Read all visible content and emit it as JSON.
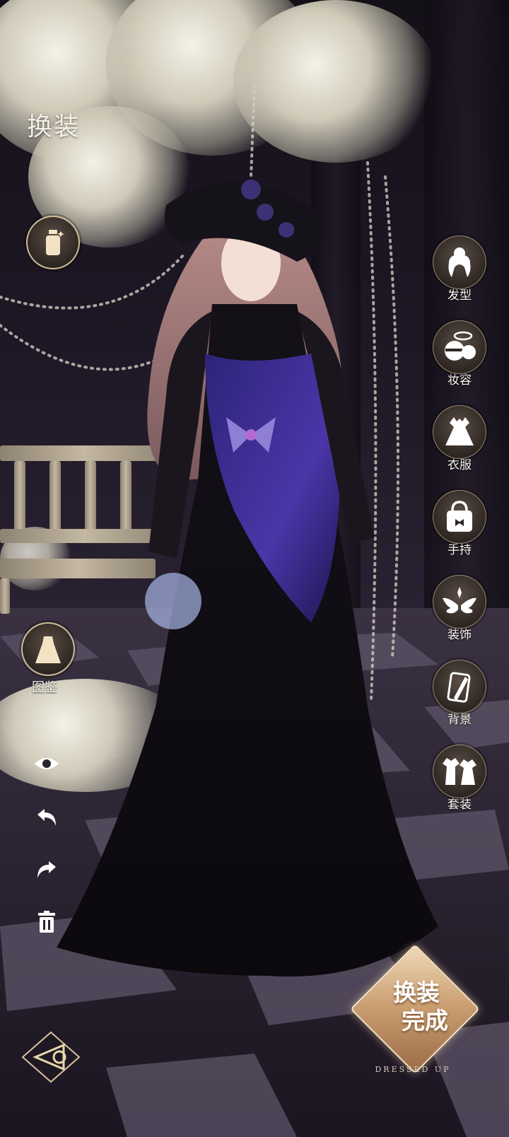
{
  "header": {
    "title": "换装"
  },
  "left_panel": {
    "gallery_label": "图鉴"
  },
  "categories": [
    {
      "label": "发型",
      "icon": "hairstyle-icon"
    },
    {
      "label": "妆容",
      "icon": "makeup-icon"
    },
    {
      "label": "衣服",
      "icon": "dress-icon"
    },
    {
      "label": "手持",
      "icon": "handbag-icon"
    },
    {
      "label": "装饰",
      "icon": "wings-ornament-icon"
    },
    {
      "label": "背景",
      "icon": "background-card-icon"
    },
    {
      "label": "套装",
      "icon": "outfit-set-icon"
    }
  ],
  "tools": [
    "eye-icon",
    "undo-icon",
    "redo-icon",
    "trash-icon"
  ],
  "finish": {
    "line1": "换装",
    "line2": "完成",
    "sub": "DRESSED UP"
  },
  "colors": {
    "gold_accent": "#e9d6aa",
    "label_text": "#fbf7ee",
    "finish_gold": "#c89c6e"
  }
}
